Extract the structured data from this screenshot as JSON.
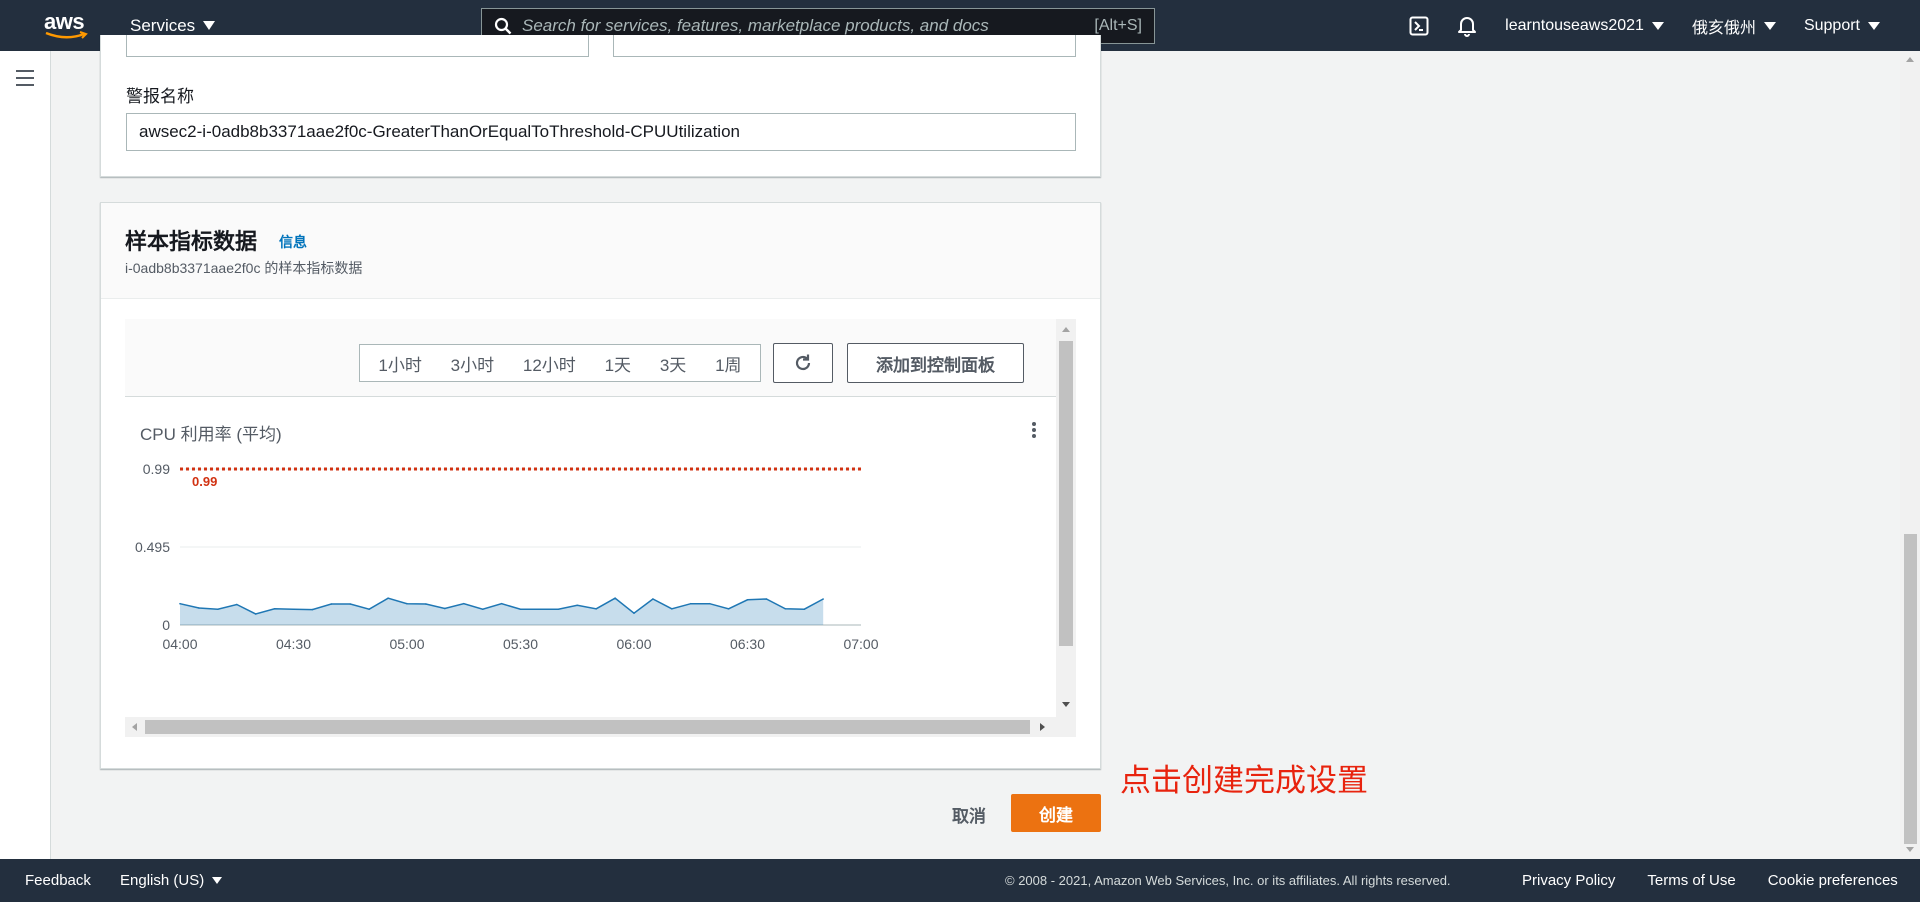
{
  "topnav": {
    "logo_text": "aws",
    "services_label": "Services",
    "search_placeholder": "Search for services, features, marketplace products, and docs",
    "search_shortcut": "[Alt+S]",
    "account": "learntouseaws2021",
    "region": "俄亥俄州",
    "support": "Support"
  },
  "alarm": {
    "name_label": "警报名称",
    "name_value": "awsec2-i-0adb8b3371aae2f0c-GreaterThanOrEqualToThreshold-CPUUtilization"
  },
  "sample": {
    "title": "样本指标数据",
    "info_link": "信息",
    "subtitle": "i-0adb8b3371aae2f0c 的样本指标数据",
    "ranges": [
      "1小时",
      "3小时",
      "12小时",
      "1天",
      "3天",
      "1周"
    ],
    "add_dashboard": "添加到控制面板",
    "graph_title": "CPU 利用率 (平均)"
  },
  "chart_data": {
    "type": "area",
    "title": "CPU 利用率 (平均)",
    "x_ticks": [
      "04:00",
      "04:30",
      "05:00",
      "05:30",
      "06:00",
      "06:30",
      "07:00"
    ],
    "y_ticks": [
      "0",
      "0.495",
      "0.99"
    ],
    "ylim": [
      0,
      0.99
    ],
    "threshold": {
      "value": 0.99,
      "label": "0.99",
      "color": "#d13212"
    },
    "series": [
      {
        "color": "#1f77b4",
        "x": [
          "04:00",
          "04:05",
          "04:10",
          "04:15",
          "04:20",
          "04:25",
          "04:30",
          "04:35",
          "04:40",
          "04:45",
          "04:50",
          "04:55",
          "05:00",
          "05:05",
          "05:10",
          "05:15",
          "05:20",
          "05:25",
          "05:30",
          "05:35",
          "05:40",
          "05:45",
          "05:50",
          "05:55",
          "06:00",
          "06:05",
          "06:10",
          "06:15",
          "06:20",
          "06:25",
          "06:30",
          "06:35",
          "06:40",
          "06:45",
          "06:50"
        ],
        "values": [
          0.135,
          0.108,
          0.1,
          0.13,
          0.07,
          0.103,
          0.1,
          0.098,
          0.133,
          0.133,
          0.1,
          0.17,
          0.135,
          0.133,
          0.105,
          0.135,
          0.1,
          0.135,
          0.1,
          0.1,
          0.1,
          0.125,
          0.103,
          0.17,
          0.075,
          0.165,
          0.103,
          0.135,
          0.135,
          0.103,
          0.16,
          0.165,
          0.103,
          0.1,
          0.165
        ]
      }
    ]
  },
  "actions": {
    "cancel": "取消",
    "create": "创建",
    "annotation": "点击创建完成设置"
  },
  "footer": {
    "feedback": "Feedback",
    "language": "English (US)",
    "copyright": "© 2008 - 2021, Amazon Web Services, Inc. or its affiliates. All rights reserved.",
    "privacy": "Privacy Policy",
    "terms": "Terms of Use",
    "cookies": "Cookie preferences"
  },
  "colors": {
    "nav_bg": "#232f3e",
    "primary_button": "#ec7211",
    "link": "#0073bb",
    "annotation": "#e8230e"
  }
}
